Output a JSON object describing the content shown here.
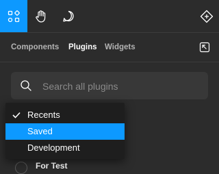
{
  "toolbar": {
    "tools": [
      {
        "icon": "shapes-icon",
        "active": true
      },
      {
        "icon": "hand-icon",
        "active": false
      },
      {
        "icon": "comment-icon",
        "active": false
      }
    ],
    "right_icon": "components-diamond-icon"
  },
  "tabs": [
    {
      "label": "Components",
      "active": false
    },
    {
      "label": "Plugins",
      "active": true
    },
    {
      "label": "Widgets",
      "active": false
    }
  ],
  "undock_icon": "undock-icon",
  "search": {
    "placeholder": "Search all plugins",
    "value": ""
  },
  "menu": {
    "items": [
      {
        "label": "Recents",
        "checked": true,
        "highlighted": false
      },
      {
        "label": "Saved",
        "checked": false,
        "highlighted": true
      },
      {
        "label": "Development",
        "checked": false,
        "highlighted": false
      }
    ]
  },
  "peek": {
    "label": "For Test"
  },
  "colors": {
    "accent": "#0d99ff",
    "panel": "#2c2c2c",
    "menu": "#1e1e1e"
  }
}
